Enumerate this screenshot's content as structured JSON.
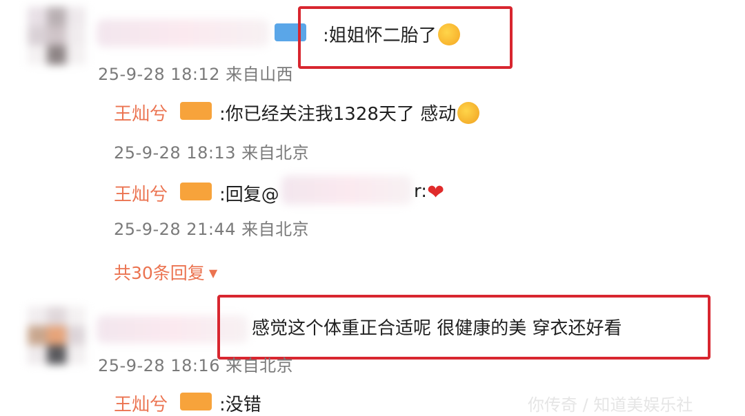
{
  "comments": [
    {
      "text": ":姐姐怀二胎了",
      "meta": "25-9-28 18:12 来自山西",
      "replies": [
        {
          "name": "王灿兮",
          "text": ":你已经关注我1328天了 感动",
          "meta": "25-9-28 18:13 来自北京"
        },
        {
          "name": "王灿兮",
          "text_before": ":回复@",
          "text_after": "r:",
          "meta": "25-9-28 21:44 来自北京"
        }
      ],
      "more_replies": "共30条回复",
      "more_icon": "caret-down-icon"
    },
    {
      "text": "感觉这个体重正合适呢 很健康的美 穿衣还好看",
      "meta": "25-9-28 18:16 来自北京",
      "replies": [
        {
          "name": "王灿兮",
          "text": ":没错"
        }
      ]
    }
  ],
  "watermark": "你传奇 / 知道美娱乐社",
  "colors": {
    "highlight_box": "#d8262f",
    "username": "#eb7350",
    "meta": "#7a7a7a",
    "vip_badge": "#f7a33b"
  }
}
